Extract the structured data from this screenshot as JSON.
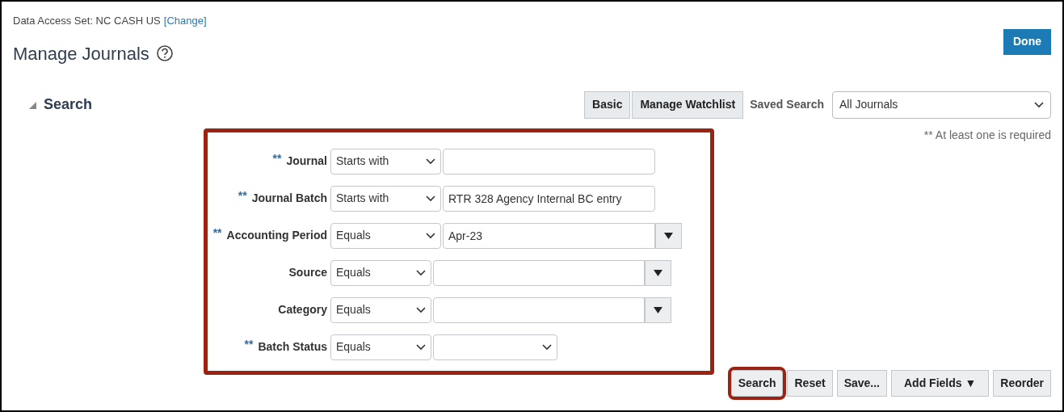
{
  "data_access": {
    "label": "Data Access Set: NC CASH US",
    "link": "[Change]"
  },
  "page": {
    "title": "Manage Journals",
    "done_button": "Done"
  },
  "search": {
    "heading": "Search",
    "expanded": true,
    "toolbar": [
      {
        "label": "Basic"
      },
      {
        "label": "Manage Watchlist"
      }
    ],
    "saved_search": {
      "label": "Saved Search",
      "value": "All Journals"
    },
    "required_note": "** At least one is required",
    "highlighted": true,
    "fields": [
      {
        "label": "Journal",
        "required_mark": "**",
        "operator": "Starts with",
        "kind": "text"
      },
      {
        "label": "Journal Batch",
        "required_mark": "**",
        "operator": "Starts with",
        "kind": "text",
        "value": "RTR 328 Agency Internal BC entry"
      },
      {
        "label": "Accounting Period",
        "required_mark": "**",
        "operator": "Equals",
        "kind": "lov",
        "value": "Apr-23"
      },
      {
        "label": "Source",
        "operator": "Equals",
        "kind": "lov"
      },
      {
        "label": "Category",
        "operator": "Equals",
        "kind": "lov"
      },
      {
        "label": "Batch Status",
        "required_mark": "**",
        "operator": "Equals",
        "kind": "select"
      }
    ],
    "buttons": [
      {
        "label": "Search",
        "highlighted": true
      },
      {
        "label": "Reset",
        "highlighted": false
      },
      {
        "label": "Save...",
        "highlighted": false
      },
      {
        "label": "Add Fields ▼",
        "highlighted": false
      },
      {
        "label": "Reorder",
        "highlighted": false
      }
    ]
  }
}
